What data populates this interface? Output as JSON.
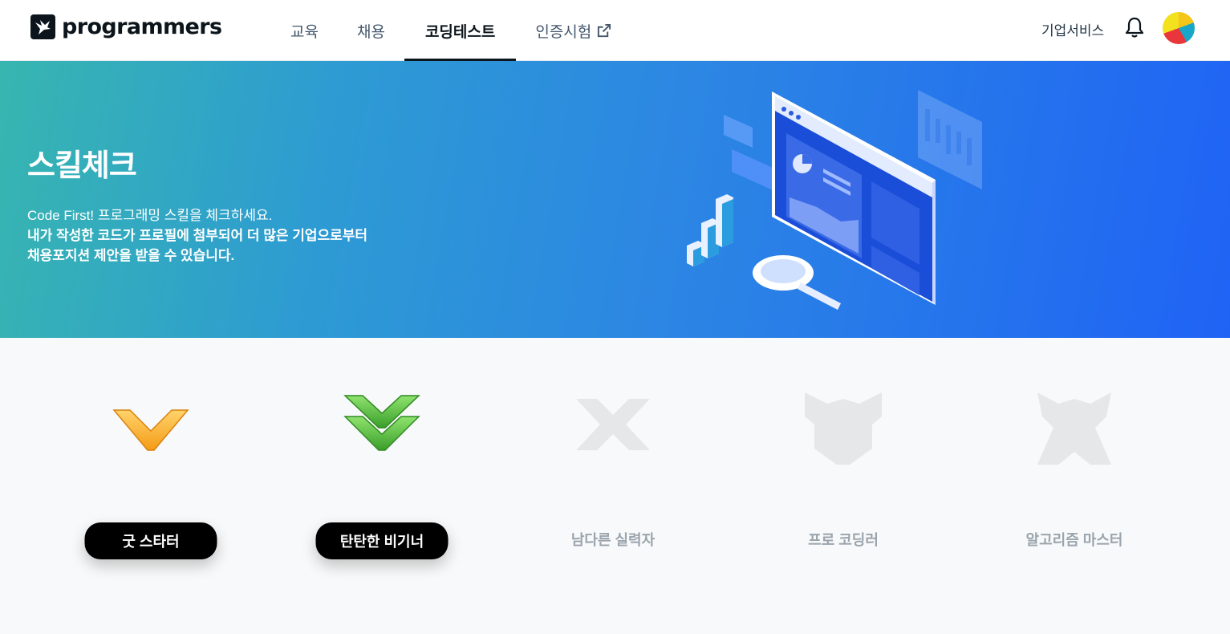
{
  "header": {
    "logo_text": "programmers",
    "nav": [
      {
        "label": "교육"
      },
      {
        "label": "채용"
      },
      {
        "label": "코딩테스트",
        "active": true
      },
      {
        "label": "인증시험",
        "external": true
      }
    ],
    "business_service": "기업서비스"
  },
  "hero": {
    "title": "스킬체크",
    "desc_line1": "Code First! 프로그래밍 스킬을 체크하세요.",
    "desc_line2": "내가 작성한 코드가 프로필에 첨부되어 더 많은 기업으로부터",
    "desc_line3": "채용포지션 제안을 받을 수 있습니다."
  },
  "badges": [
    {
      "label": "굿 스타터",
      "earned": true,
      "icon": "orange-chevron-icon",
      "color": "#f5a623"
    },
    {
      "label": "탄탄한 비기너",
      "earned": true,
      "icon": "green-double-chevron-icon",
      "color": "#4caf3c"
    },
    {
      "label": "남다른 실력자",
      "earned": false,
      "icon": "locked-x-badge-icon"
    },
    {
      "label": "프로 코딩러",
      "earned": false,
      "icon": "locked-shield-badge-icon"
    },
    {
      "label": "알고리즘 마스터",
      "earned": false,
      "icon": "locked-crown-badge-icon"
    }
  ]
}
